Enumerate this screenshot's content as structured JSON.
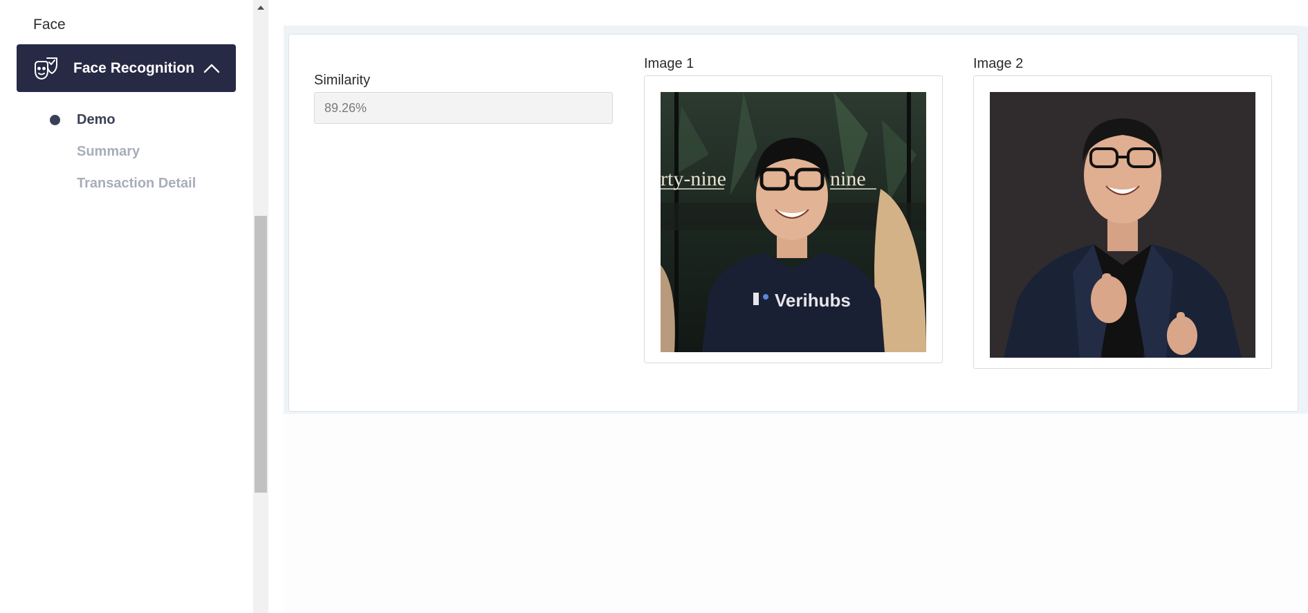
{
  "sidebar": {
    "section_label": "Face",
    "active_menu": {
      "label": "Face Recognition",
      "icon": "face-mask-shield-icon",
      "expand_icon": "chevron-up-icon"
    },
    "submenu": [
      {
        "label": "Demo",
        "active": true
      },
      {
        "label": "Summary",
        "active": false
      },
      {
        "label": "Transaction Detail",
        "active": false
      }
    ]
  },
  "main": {
    "similarity": {
      "label": "Similarity",
      "value": "89.26%"
    },
    "image1": {
      "label": "Image 1",
      "shirt_text": "Verihubs",
      "sign_left": "rty-nine",
      "sign_right": "nine"
    },
    "image2": {
      "label": "Image 2"
    }
  },
  "colors": {
    "menu_active_bg": "#272a45",
    "submenu_active": "#3a3f55",
    "submenu_inactive": "#a7adb9"
  }
}
